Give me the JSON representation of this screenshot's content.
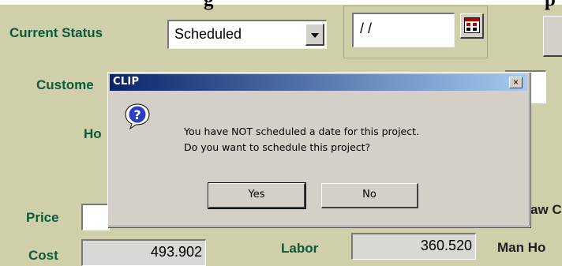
{
  "form": {
    "heading_partial": "g",
    "heading_partial_right": "p",
    "current_status_label": "Current Status",
    "status_value": "Scheduled",
    "date_value": "/ /",
    "customer_label": "Custome",
    "ho_label": "Ho",
    "price_label": "Price",
    "cost_label": "Cost",
    "cost_value": "493.902",
    "labor_label": "Labor",
    "labor_value": "360.520",
    "man_hours_label": "Man Ho",
    "raw_label": "aw C"
  },
  "dialog": {
    "title": "CLIP",
    "message_line1": "You have NOT scheduled a date for this project.",
    "message_line2": "Do you want to schedule this project?",
    "yes_label": "Yes",
    "no_label": "No",
    "icon": "question-icon",
    "close_glyph": "×"
  },
  "colors": {
    "background": "#cfcfa9",
    "label_green": "#0b5a3a",
    "titlebar_start": "#0a246a",
    "titlebar_end": "#a6caf0"
  }
}
